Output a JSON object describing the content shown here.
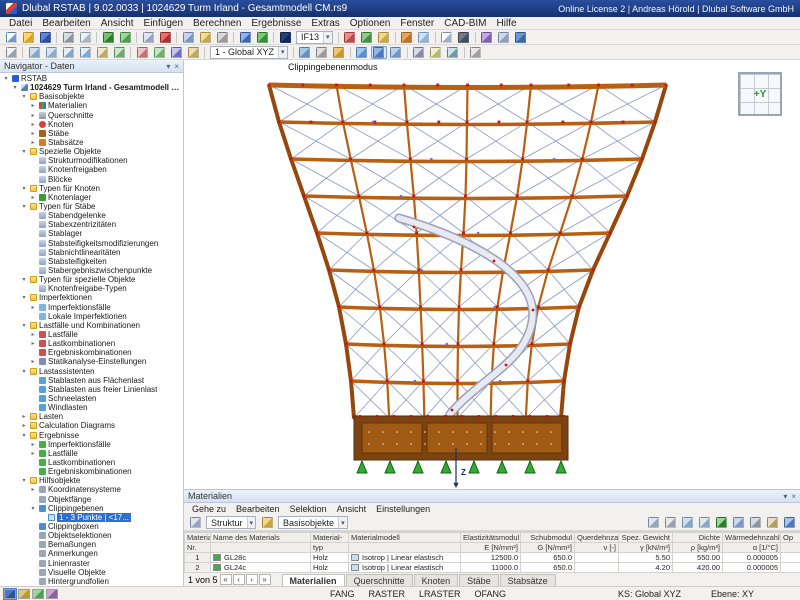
{
  "titlebar": {
    "title": "Dlubal RSTAB | 9.02.0033 | 1024629 Turm Irland - Gesamtmodell CM.rs9",
    "right_text": "Online License 2 | Andreas Hörold | Dlubal Software GmbH"
  },
  "menubar": {
    "items": [
      {
        "key": "datei",
        "label": "Datei"
      },
      {
        "key": "bearbeiten",
        "label": "Bearbeiten"
      },
      {
        "key": "ansicht",
        "label": "Ansicht"
      },
      {
        "key": "einfuegen",
        "label": "Einfügen"
      },
      {
        "key": "berechnen",
        "label": "Berechnen"
      },
      {
        "key": "ergebnisse",
        "label": "Ergebnisse"
      },
      {
        "key": "extras",
        "label": "Extras"
      },
      {
        "key": "optionen",
        "label": "Optionen"
      },
      {
        "key": "fenster",
        "label": "Fenster"
      },
      {
        "key": "cad-bim",
        "label": "CAD-BIM"
      },
      {
        "key": "hilfe",
        "label": "Hilfe"
      }
    ]
  },
  "toolbar_row1": {
    "items": [
      {
        "k": "new-model",
        "c": [
          "#ffffff",
          "#6b9bd2"
        ]
      },
      {
        "k": "open-model",
        "c": [
          "#ffd867",
          "#d9a33a"
        ]
      },
      {
        "k": "save-model",
        "c": [
          "#5b84d6",
          "#2c4f96"
        ]
      },
      {
        "k": "sep"
      },
      {
        "k": "print",
        "c": [
          "#d8dce2",
          "#8e959e"
        ]
      },
      {
        "k": "print-preview",
        "c": [
          "#eef1f5",
          "#aab6c8"
        ]
      },
      {
        "k": "sep"
      },
      {
        "k": "undo",
        "c": [
          "#74c274",
          "#2f7d2f"
        ]
      },
      {
        "k": "redo",
        "c": [
          "#9ad89a",
          "#4f9d4f"
        ]
      },
      {
        "k": "sep"
      },
      {
        "k": "copy",
        "c": [
          "#dfe6f0",
          "#93a5c0"
        ]
      },
      {
        "k": "delete",
        "c": [
          "#e87070",
          "#b03030"
        ]
      },
      {
        "k": "sep"
      },
      {
        "k": "renumber",
        "c": [
          "#c8d4ee",
          "#7f97c8"
        ]
      },
      {
        "k": "display-properties",
        "c": [
          "#f0e0a0",
          "#caa84e"
        ]
      },
      {
        "k": "units-settings",
        "c": [
          "#d8d8d8",
          "#9a9a9a"
        ]
      },
      {
        "k": "sep"
      },
      {
        "k": "calculate-all",
        "c": [
          "#8fb4e8",
          "#4066b0"
        ]
      },
      {
        "k": "check-model",
        "c": [
          "#79c879",
          "#379037"
        ]
      },
      {
        "k": "sep"
      },
      {
        "k": "load-group-toggle",
        "c": [
          "#23407e",
          "#12264f"
        ]
      },
      {
        "k": "imperfection-combo",
        "combo": "IF13"
      },
      {
        "k": "sep"
      },
      {
        "k": "show-loads",
        "c": [
          "#e89090",
          "#c04848"
        ]
      },
      {
        "k": "show-supports",
        "c": [
          "#90c890",
          "#47903f"
        ]
      },
      {
        "k": "show-numbering",
        "c": [
          "#f0d890",
          "#c8a848"
        ]
      },
      {
        "k": "sep"
      },
      {
        "k": "render-solid",
        "c": [
          "#e8a85a",
          "#b8762a"
        ]
      },
      {
        "k": "render-transparent",
        "c": [
          "#cfe2f4",
          "#8fb2da"
        ]
      },
      {
        "k": "sep"
      },
      {
        "k": "new-window",
        "c": [
          "#ffffff",
          "#9ab0cc"
        ]
      },
      {
        "k": "print-graphic",
        "c": [
          "#707a88",
          "#454e5a"
        ]
      },
      {
        "k": "sep"
      },
      {
        "k": "addon-modules",
        "c": [
          "#c0a8e0",
          "#8060b0"
        ]
      },
      {
        "k": "program-settings",
        "c": [
          "#d0d8e8",
          "#8aa0c0"
        ]
      },
      {
        "k": "help",
        "c": [
          "#6f9ad0",
          "#3c66a8"
        ]
      }
    ]
  },
  "toolbar_row2": {
    "items": [
      {
        "k": "select-objects",
        "c": [
          "#f4f4f4",
          "#9aa2ae"
        ]
      },
      {
        "k": "sep"
      },
      {
        "k": "zoom-extents",
        "c": [
          "#cfe0f0",
          "#7fa8cc"
        ]
      },
      {
        "k": "zoom-window",
        "c": [
          "#d8e6f2",
          "#88aed0"
        ]
      },
      {
        "k": "zoom-in",
        "c": [
          "#e8eef6",
          "#7fa8cc"
        ]
      },
      {
        "k": "zoom-out",
        "c": [
          "#e8eef6",
          "#7fa8cc"
        ]
      },
      {
        "k": "pan-view",
        "c": [
          "#f0e8d0",
          "#c0a860"
        ]
      },
      {
        "k": "rotate-view",
        "c": [
          "#d0e8d0",
          "#70a870"
        ]
      },
      {
        "k": "sep"
      },
      {
        "k": "view-x",
        "c": [
          "#ecc6c6",
          "#c87070"
        ]
      },
      {
        "k": "view-y",
        "c": [
          "#c6e4c6",
          "#6fb06f"
        ]
      },
      {
        "k": "view-z",
        "c": [
          "#c6c6ec",
          "#7070c8"
        ]
      },
      {
        "k": "isometric-view",
        "c": [
          "#eadfb2",
          "#c0a860"
        ]
      },
      {
        "k": "sep"
      },
      {
        "k": "coordinate-system-combo",
        "combo": "1 - Global XYZ"
      },
      {
        "k": "sep"
      },
      {
        "k": "work-plane",
        "c": [
          "#a8c8e8",
          "#6890c0"
        ]
      },
      {
        "k": "grid-toggle",
        "c": [
          "#e0e0e0",
          "#9a9a9a"
        ]
      },
      {
        "k": "snap-toggle",
        "c": [
          "#f0c870",
          "#c89830"
        ]
      },
      {
        "k": "sep"
      },
      {
        "k": "visibility-modes",
        "c": [
          "#9ec8ee",
          "#5890c8"
        ]
      },
      {
        "k": "clipping-plane",
        "c": [
          "#8fb8e8",
          "#4f78b8"
        ],
        "on": true
      },
      {
        "k": "clipping-box",
        "c": [
          "#b8d2ee",
          "#6f98c8"
        ]
      },
      {
        "k": "sep"
      },
      {
        "k": "dimensions",
        "c": [
          "#d8d8e8",
          "#8888a8"
        ]
      },
      {
        "k": "annotations",
        "c": [
          "#f0f0d0",
          "#b8b870"
        ]
      },
      {
        "k": "measure",
        "c": [
          "#d0e0e8",
          "#7098a8"
        ]
      },
      {
        "k": "sep"
      },
      {
        "k": "fullscreen",
        "c": [
          "#e8e8e8",
          "#a0a0a0"
        ]
      }
    ]
  },
  "navigator": {
    "header": "Navigator - Daten",
    "tabs": [
      {
        "k": "daten",
        "c": [
          "#4a76c8",
          "#2c4f96"
        ],
        "active": true
      },
      {
        "k": "zeigen",
        "c": [
          "#e0c870",
          "#b89830"
        ]
      },
      {
        "k": "ansichten",
        "c": [
          "#9ad89a",
          "#4f9d4f"
        ]
      },
      {
        "k": "ergebnisse",
        "c": [
          "#d0a0d0",
          "#9060a0"
        ]
      }
    ],
    "items": [
      {
        "k": "rstab-root",
        "lb": "RSTAB",
        "d": 0,
        "i": "app",
        "a": "e"
      },
      {
        "k": "model-file",
        "lb": "1024629 Turm Irland - Gesamtmodell CM.rs9",
        "d": 1,
        "i": "model",
        "a": "e",
        "b": 1
      },
      {
        "k": "basisobjekte",
        "lb": "Basisobjekte",
        "d": 2,
        "i": "folder",
        "a": "e"
      },
      {
        "k": "materialien",
        "lb": "Materialien",
        "d": 3,
        "i": "mat",
        "a": "c"
      },
      {
        "k": "querschnitte",
        "lb": "Querschnitte",
        "d": 3,
        "i": "sec",
        "a": "c"
      },
      {
        "k": "knoten",
        "lb": "Knoten",
        "d": 3,
        "i": "node",
        "a": "c"
      },
      {
        "k": "staebe",
        "lb": "Stäbe",
        "d": 3,
        "i": "member",
        "a": "c"
      },
      {
        "k": "stabsaetze",
        "lb": "Stabsätze",
        "d": 3,
        "i": "mset",
        "a": "c"
      },
      {
        "k": "spezielle-objekte",
        "lb": "Spezielle Objekte",
        "d": 2,
        "i": "folder",
        "a": "e"
      },
      {
        "k": "strukturmodifikationen",
        "lb": "Strukturmodifikationen",
        "d": 3,
        "i": "gen"
      },
      {
        "k": "knotenfreigaben",
        "lb": "Knotenfreigaben",
        "d": 3,
        "i": "gen"
      },
      {
        "k": "bloecke",
        "lb": "Blöcke",
        "d": 3,
        "i": "gen"
      },
      {
        "k": "typen-fuer-knoten",
        "lb": "Typen für Knoten",
        "d": 2,
        "i": "folder",
        "a": "e"
      },
      {
        "k": "knotenlager",
        "lb": "Knotenlager",
        "d": 3,
        "i": "sup",
        "a": "c"
      },
      {
        "k": "typen-fuer-staebe",
        "lb": "Typen für Stäbe",
        "d": 2,
        "i": "folder",
        "a": "e"
      },
      {
        "k": "stabendgelenke",
        "lb": "Stabendgelenke",
        "d": 3,
        "i": "gen"
      },
      {
        "k": "stabexzentrizitaeten",
        "lb": "Stabexzentrizitäten",
        "d": 3,
        "i": "gen"
      },
      {
        "k": "stablager",
        "lb": "Stablager",
        "d": 3,
        "i": "gen"
      },
      {
        "k": "stabsteifigkeitsmodifizierungen",
        "lb": "Stabsteifigkeitsmodifizierungen",
        "d": 3,
        "i": "gen"
      },
      {
        "k": "stabnichtlinearitaeten",
        "lb": "Stabnichtlinearitäten",
        "d": 3,
        "i": "gen"
      },
      {
        "k": "stabsteifigkeiten",
        "lb": "Stabsteifigkeiten",
        "d": 3,
        "i": "gen"
      },
      {
        "k": "stabergebniszwischenpunkte",
        "lb": "Stabergebniszwischenpunkte",
        "d": 3,
        "i": "gen"
      },
      {
        "k": "typen-fuer-spezielle-objekte",
        "lb": "Typen für spezielle Objekte",
        "d": 2,
        "i": "folder",
        "a": "e"
      },
      {
        "k": "knotenfreigabe-typen",
        "lb": "Knotenfreigabe-Typen",
        "d": 3,
        "i": "gen"
      },
      {
        "k": "imperfektionen",
        "lb": "Imperfektionen",
        "d": 2,
        "i": "folder",
        "a": "e"
      },
      {
        "k": "imperfektionsfaelle",
        "lb": "Imperfektionsfälle",
        "d": 3,
        "i": "imp",
        "a": "c"
      },
      {
        "k": "lokale-imperfektionen",
        "lb": "Lokale Imperfektionen",
        "d": 3,
        "i": "imp"
      },
      {
        "k": "lastfaelle-und-kombinationen",
        "lb": "Lastfälle und Kombinationen",
        "d": 2,
        "i": "folder",
        "a": "e"
      },
      {
        "k": "lastfaelle",
        "lb": "Lastfälle",
        "d": 3,
        "i": "load",
        "a": "c"
      },
      {
        "k": "lastkombinationen",
        "lb": "Lastkombinationen",
        "d": 3,
        "i": "load",
        "a": "c"
      },
      {
        "k": "ergebniskombinationen",
        "lb": "Ergebniskombinationen",
        "d": 3,
        "i": "load"
      },
      {
        "k": "statikanalyse-einstellungen",
        "lb": "Statikanalyse-Einstellungen",
        "d": 3,
        "i": "calc",
        "a": "c"
      },
      {
        "k": "lastassistenten",
        "lb": "Lastassistenten",
        "d": 2,
        "i": "folder",
        "a": "e"
      },
      {
        "k": "stablasten-aus-flaechenlast",
        "lb": "Stablasten aus Flächenlast",
        "d": 3,
        "i": "ass"
      },
      {
        "k": "stablasten-aus-freier-linienlast",
        "lb": "Stablasten aus freier Linienlast",
        "d": 3,
        "i": "ass"
      },
      {
        "k": "schneelasten",
        "lb": "Schneelasten",
        "d": 3,
        "i": "ass"
      },
      {
        "k": "windlasten",
        "lb": "Windlasten",
        "d": 3,
        "i": "ass"
      },
      {
        "k": "lasten",
        "lb": "Lasten",
        "d": 2,
        "i": "folder",
        "a": "c"
      },
      {
        "k": "calculation-diagrams",
        "lb": "Calculation Diagrams",
        "d": 2,
        "i": "folder",
        "a": "c"
      },
      {
        "k": "ergebnisse",
        "lb": "Ergebnisse",
        "d": 2,
        "i": "folder",
        "a": "e"
      },
      {
        "k": "ergebnisse-imperfektionsfaelle",
        "lb": "Imperfektionsfälle",
        "d": 3,
        "i": "res",
        "a": "c"
      },
      {
        "k": "ergebnisse-lastfaelle",
        "lb": "Lastfälle",
        "d": 3,
        "i": "res",
        "a": "c"
      },
      {
        "k": "ergebnisse-lastkombinationen",
        "lb": "Lastkombinationen",
        "d": 3,
        "i": "res"
      },
      {
        "k": "ergebnisse-ergebniskombinationen",
        "lb": "Ergebniskombinationen",
        "d": 3,
        "i": "res"
      },
      {
        "k": "hilfsobjekte",
        "lb": "Hilfsobjekte",
        "d": 2,
        "i": "folder",
        "a": "e"
      },
      {
        "k": "koordinatensysteme",
        "lb": "Koordinatensysteme",
        "d": 3,
        "i": "hlp",
        "a": "c"
      },
      {
        "k": "objektfaenge",
        "lb": "Objektfänge",
        "d": 3,
        "i": "hlp"
      },
      {
        "k": "clippingebenen",
        "lb": "Clippingebenen",
        "d": 3,
        "i": "clip",
        "a": "e"
      },
      {
        "k": "clippingebene-1-3-punkte",
        "lb": "1 - 3 Punkte | <17...",
        "d": 4,
        "i": "clip2",
        "sel": 1
      },
      {
        "k": "clippingboxen",
        "lb": "Clippingboxen",
        "d": 3,
        "i": "clip"
      },
      {
        "k": "objektselektionen",
        "lb": "Objektselektionen",
        "d": 3,
        "i": "hlp"
      },
      {
        "k": "bemassungen",
        "lb": "Bemaßungen",
        "d": 3,
        "i": "hlp"
      },
      {
        "k": "anmerkungen",
        "lb": "Anmerkungen",
        "d": 3,
        "i": "hlp"
      },
      {
        "k": "linienraster",
        "lb": "Linienraster",
        "d": 3,
        "i": "hlp"
      },
      {
        "k": "visuelle-objekte",
        "lb": "Visuelle Objekte",
        "d": 3,
        "i": "hlp"
      },
      {
        "k": "hintergrundfolien",
        "lb": "Hintergrundfolien",
        "d": 3,
        "i": "hlp"
      }
    ]
  },
  "viewport": {
    "mode_label": "Clippingebenenmodus",
    "cube_label": "+Y",
    "z_label": "Z"
  },
  "panel": {
    "title": "Materialien",
    "menus": [
      {
        "key": "gehe-zu",
        "label": "Gehe zu"
      },
      {
        "key": "bearbeiten",
        "label": "Bearbeiten"
      },
      {
        "key": "selektion",
        "label": "Selektion"
      },
      {
        "key": "ansicht",
        "label": "Ansicht"
      },
      {
        "key": "einstellungen",
        "label": "Einstellungen"
      }
    ],
    "toolbar_items": [
      {
        "k": "panel-nav-back",
        "c": [
          "#dfe6f0",
          "#93a5c0"
        ]
      },
      {
        "k": "struktur-combo",
        "combo": "Struktur"
      },
      {
        "k": "filter-rows",
        "c": [
          "#f0d890",
          "#c8a040"
        ]
      },
      {
        "k": "basisobjekte-combo",
        "combo": "Basisobjekte"
      },
      {
        "k": "flex"
      },
      {
        "k": "table-edit",
        "c": [
          "#dfe6f0",
          "#93a5c0"
        ]
      },
      {
        "k": "table-search",
        "c": [
          "#e8e8e8",
          "#9aa2ae"
        ]
      },
      {
        "k": "table-sort",
        "c": [
          "#d0e0f0",
          "#7fa8cc"
        ]
      },
      {
        "k": "table-columns",
        "c": [
          "#e0e8f0",
          "#88a8c8"
        ]
      },
      {
        "k": "export-excel",
        "c": [
          "#9ad89a",
          "#2f7d2f"
        ]
      },
      {
        "k": "import-table",
        "c": [
          "#c8d8ee",
          "#7f97c8"
        ]
      },
      {
        "k": "table-print",
        "c": [
          "#d8dce2",
          "#8e959e"
        ]
      },
      {
        "k": "table-settings",
        "c": [
          "#e8e0c8",
          "#b0a060"
        ]
      },
      {
        "k": "table-help",
        "c": [
          "#a8c4e8",
          "#4f78b8"
        ]
      }
    ]
  },
  "table": {
    "columns": [
      {
        "key": "nr",
        "l1": "Material",
        "l2": "Nr."
      },
      {
        "key": "name",
        "l1": "Name des Materials",
        "l2": ""
      },
      {
        "key": "typ",
        "l1": "Material-",
        "l2": "typ"
      },
      {
        "key": "modell",
        "l1": "Materialmodell",
        "l2": ""
      },
      {
        "key": "e",
        "l1": "Elastizitätsmodul",
        "l2": "E [N/mm²]"
      },
      {
        "key": "g",
        "l1": "Schubmodul",
        "l2": "G [N/mm²]"
      },
      {
        "key": "nu",
        "l1": "Querdehnzahl",
        "l2": "ν [-]"
      },
      {
        "key": "gamma",
        "l1": "Spez. Gewicht",
        "l2": "γ [kN/m³]"
      },
      {
        "key": "rho",
        "l1": "Dichte",
        "l2": "ρ [kg/m³]"
      },
      {
        "key": "alpha",
        "l1": "Wärmedehnzahl",
        "l2": "α [1/°C]"
      },
      {
        "key": "op",
        "l1": "Op",
        "l2": ""
      }
    ],
    "rows": [
      {
        "nr": "1",
        "chip": "#3fae49",
        "name": "GL28c",
        "typ": "Holz",
        "mchip": "#bfe3f2",
        "modell": "Isotrop | Linear elastisch",
        "e": "12500.0",
        "g": "650.0",
        "nu": "",
        "gamma": "5.50",
        "rho": "550.00",
        "alpha": "0.000005",
        "op": ""
      },
      {
        "nr": "2",
        "chip": "#3fae49",
        "name": "GL24c",
        "typ": "Holz",
        "mchip": "#bfe3f2",
        "modell": "Isotrop | Linear elastisch",
        "e": "11000.0",
        "g": "650.0",
        "nu": "",
        "gamma": "4.20",
        "rho": "420.00",
        "alpha": "0.000005",
        "op": ""
      }
    ]
  },
  "record_nav": {
    "label": "1 von 5",
    "buttons": [
      {
        "k": "first-record",
        "g": "«"
      },
      {
        "k": "prev-record",
        "g": "‹"
      },
      {
        "k": "next-record",
        "g": "›"
      },
      {
        "k": "last-record",
        "g": "»"
      }
    ]
  },
  "bottom_tabs": {
    "items": [
      {
        "key": "materialien",
        "label": "Materialien",
        "active": true
      },
      {
        "key": "querschnitte",
        "label": "Querschnitte"
      },
      {
        "key": "knoten",
        "label": "Knoten"
      },
      {
        "key": "staebe",
        "label": "Stäbe"
      },
      {
        "key": "stabsaetze",
        "label": "Stabsätze"
      }
    ]
  },
  "statusbar": {
    "snaps": [
      "FANG",
      "RASTER",
      "LRASTER",
      "OFANG"
    ],
    "ks_label": "KS: Global XYZ",
    "plane_label": "Ebene: XY"
  },
  "colors": {
    "accent": "#2e6fd0",
    "selection": "#2e6fd0",
    "titlebar": "#1c3c80",
    "timber": "#b85f12",
    "timber_dark": "#96470b",
    "brace": "#8a97c6",
    "marker": "#cc1111",
    "node": "#7a6ad0",
    "support": "#2fae2f",
    "base": "#a05a14",
    "base_dark": "#7c4410",
    "spiral_out": "#9aa0b8",
    "spiral_in": "#e9e9f2",
    "axis": "#1a2a6a",
    "chip_green": "#3fae49",
    "chip_blue": "#bfe3f2"
  }
}
